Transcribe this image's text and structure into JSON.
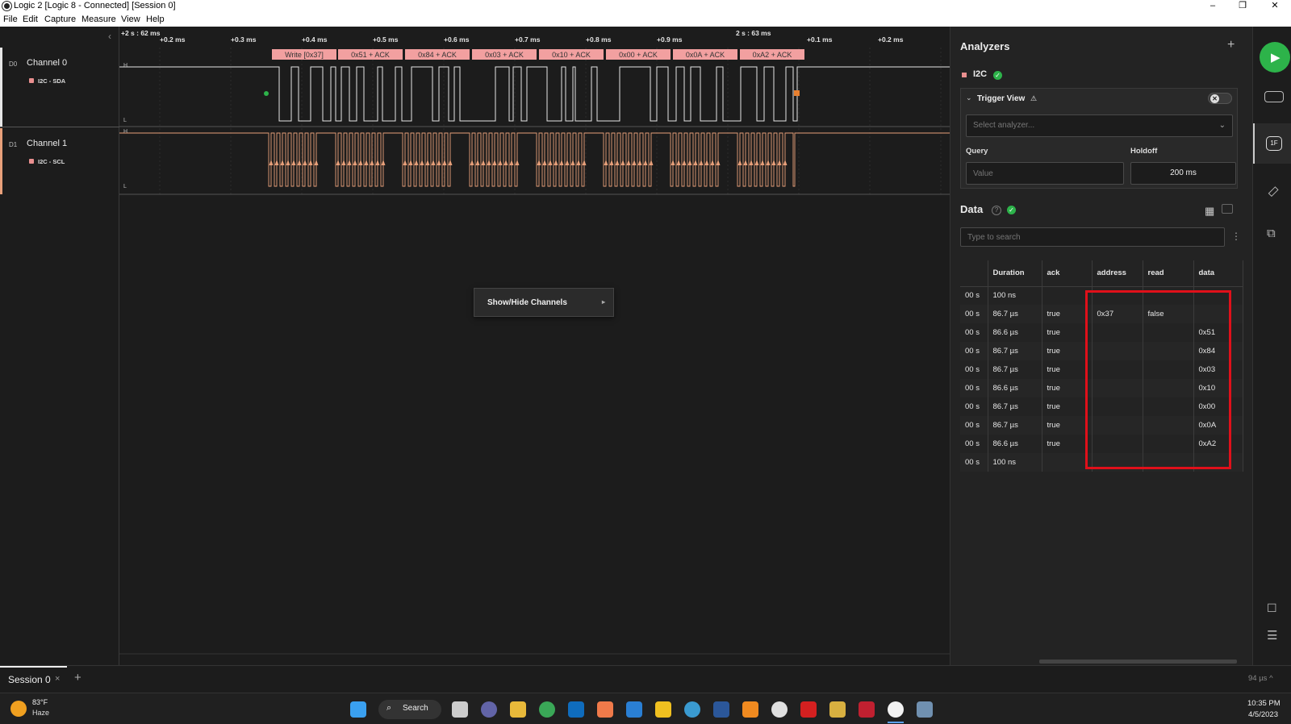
{
  "window": {
    "title": "Logic 2 [Logic 8 - Connected] [Session 0]",
    "min": "–",
    "max": "❐",
    "close": "✕"
  },
  "menu": [
    "File",
    "Edit",
    "Capture",
    "Measure",
    "View",
    "Help"
  ],
  "ruler": {
    "left_label": "+2 s : 62 ms",
    "right_label": "2 s : 63 ms",
    "ticks": [
      "+0.2 ms",
      "+0.3 ms",
      "+0.4 ms",
      "+0.5 ms",
      "+0.6 ms",
      "+0.7 ms",
      "+0.8 ms",
      "+0.9 ms",
      "+0.1 ms",
      "+0.2 ms"
    ]
  },
  "channels": [
    {
      "id": "D0",
      "name": "Channel 0",
      "analyzer_label": "I2C - SDA",
      "high": "H",
      "low": "L"
    },
    {
      "id": "D1",
      "name": "Channel 1",
      "analyzer_label": "I2C - SCL",
      "high": "H",
      "low": "L"
    }
  ],
  "decoded_bubbles": [
    "Write [0x37]",
    "0x51 + ACK",
    "0x84 + ACK",
    "0x03 + ACK",
    "0x10 + ACK",
    "0x00 + ACK",
    "0x0A + ACK",
    "0xA2 + ACK"
  ],
  "context_menu": {
    "label": "Show/Hide Channels",
    "arrow": "▸"
  },
  "analyzers_panel": {
    "title": "Analyzers",
    "add": "+",
    "analyzer_name": "I2C",
    "trigger_title": "Trigger View",
    "warn": "⚠",
    "select_placeholder": "Select analyzer...",
    "query_label": "Query",
    "query_placeholder": "Value",
    "holdoff_label": "Holdoff",
    "holdoff_value": "200 ms"
  },
  "data_panel": {
    "title": "Data",
    "search_placeholder": "Type to search",
    "columns": [
      "",
      "Duration",
      "ack",
      "address",
      "read",
      "data"
    ],
    "rows": [
      [
        "00 s",
        "100 ns",
        "",
        "",
        "",
        ""
      ],
      [
        "00 s",
        "86.7 µs",
        "true",
        "0x37",
        "false",
        ""
      ],
      [
        "00 s",
        "86.6 µs",
        "true",
        "",
        "",
        "0x51"
      ],
      [
        "00 s",
        "86.7 µs",
        "true",
        "",
        "",
        "0x84"
      ],
      [
        "00 s",
        "86.7 µs",
        "true",
        "",
        "",
        "0x03"
      ],
      [
        "00 s",
        "86.6 µs",
        "true",
        "",
        "",
        "0x10"
      ],
      [
        "00 s",
        "86.7 µs",
        "true",
        "",
        "",
        "0x00"
      ],
      [
        "00 s",
        "86.7 µs",
        "true",
        "",
        "",
        "0x0A"
      ],
      [
        "00 s",
        "86.6 µs",
        "true",
        "",
        "",
        "0xA2"
      ],
      [
        "00 s",
        "100 ns",
        "",
        "",
        "",
        ""
      ]
    ]
  },
  "session": {
    "tab": "Session 0",
    "close": "×",
    "add": "+",
    "status": "94 µs ^"
  },
  "taskbar": {
    "weather_temp": "83°F",
    "weather_desc": "Haze",
    "search": "Search",
    "time": "10:35 PM",
    "date": "4/5/2023"
  },
  "colors": {
    "accent_green": "#2db34a",
    "trace_sda": "#e6e6e6",
    "trace_scl": "#e8a07a",
    "bubble": "#f2a0a0",
    "highlight_red": "#e0101a"
  }
}
